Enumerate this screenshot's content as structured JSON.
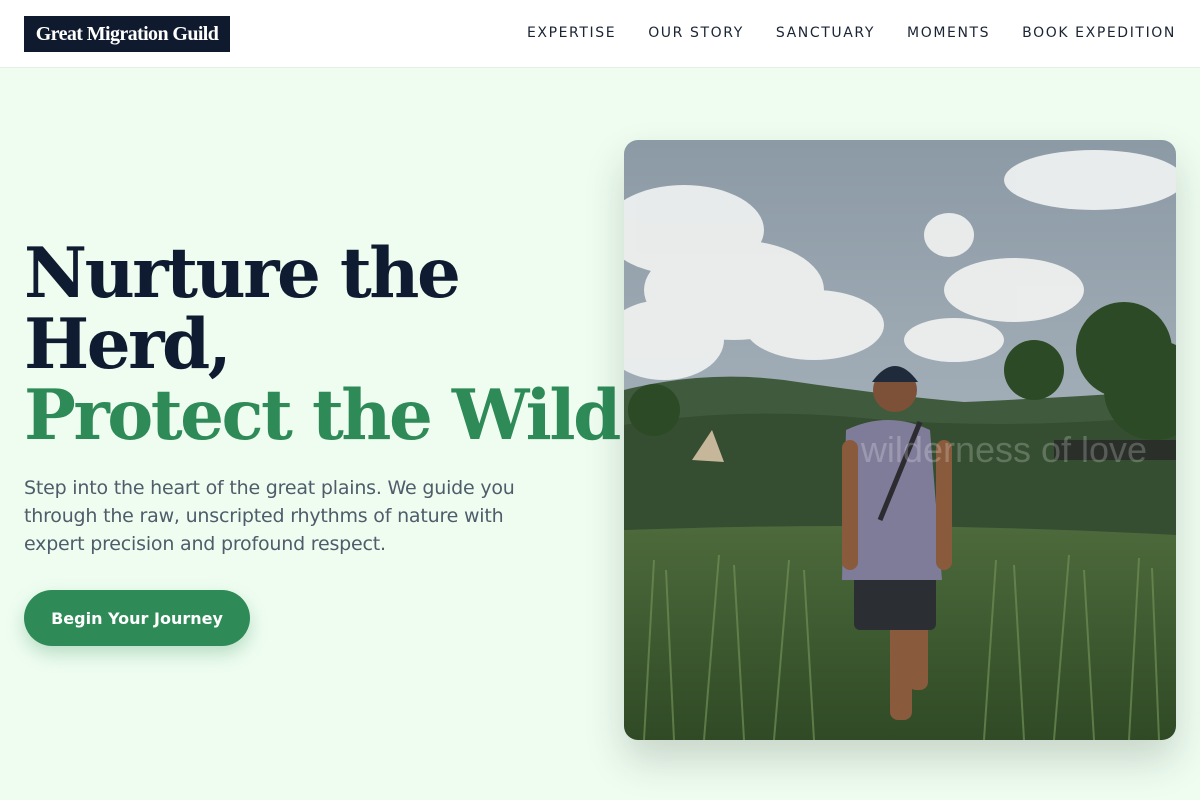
{
  "header": {
    "logo": "Great Migration Guild",
    "nav": [
      "EXPERTISE",
      "OUR STORY",
      "SANCTUARY",
      "MOMENTS",
      "BOOK EXPEDITION"
    ]
  },
  "hero": {
    "title_line1": "Nurture the",
    "title_line2": "Herd,",
    "title_line3": "Protect the Wild.",
    "subtitle": "Step into the heart of the great plains. We guide you through the raw, unscripted rhythms of nature with expert precision and profound respect.",
    "cta_label": "Begin Your Journey"
  },
  "photo": {
    "watermark": "wilderness of love"
  },
  "colors": {
    "background": "#effdf1",
    "navy": "#0f1b30",
    "green_accent": "#2e8b57"
  }
}
